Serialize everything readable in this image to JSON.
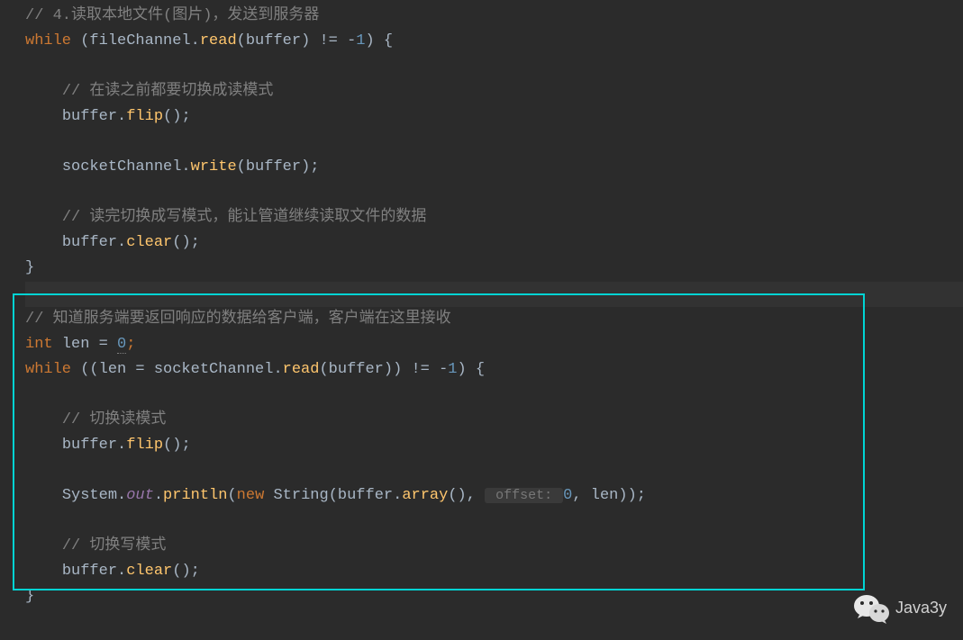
{
  "code": {
    "line1_comment": "// 4.读取本地文件(图片)，发送到服务器",
    "line2_while": "while",
    "line2_rest1": " (fileChannel.",
    "line2_read": "read",
    "line2_rest2": "(buffer) != -",
    "line2_num1": "1",
    "line2_rest3": ") {",
    "line4_comment": "// 在读之前都要切换成读模式",
    "line5_rest1": "buffer.",
    "line5_flip": "flip",
    "line5_rest2": "();",
    "line7_rest1": "socketChannel.",
    "line7_write": "write",
    "line7_rest2": "(buffer);",
    "line9_comment": "// 读完切换成写模式，能让管道继续读取文件的数据",
    "line10_rest1": "buffer.",
    "line10_clear": "clear",
    "line10_rest2": "();",
    "line11_brace": "}",
    "line13_comment": "// 知道服务端要返回响应的数据给客户端，客户端在这里接收",
    "line14_int": "int",
    "line14_rest1": " len = ",
    "line14_zero": "0",
    "line14_semi": ";",
    "line15_while": "while",
    "line15_rest1": " ((len = socketChannel.",
    "line15_read": "read",
    "line15_rest2": "(buffer)) != -",
    "line15_num1": "1",
    "line15_rest3": ") {",
    "line17_comment": "// 切换读模式",
    "line18_rest1": "buffer.",
    "line18_flip": "flip",
    "line18_rest2": "();",
    "line20_rest1": "System.",
    "line20_out": "out",
    "line20_rest2": ".",
    "line20_println": "println",
    "line20_rest3": "(",
    "line20_new": "new",
    "line20_rest4": " String(buffer.",
    "line20_array": "array",
    "line20_rest5": "(), ",
    "line20_hint": " offset: ",
    "line20_zero": "0",
    "line20_rest6": ", len));",
    "line22_comment": "// 切换写模式",
    "line23_rest1": "buffer.",
    "line23_clear": "clear",
    "line23_rest2": "();",
    "line24_brace": "}"
  },
  "watermark": {
    "text": "Java3y"
  }
}
